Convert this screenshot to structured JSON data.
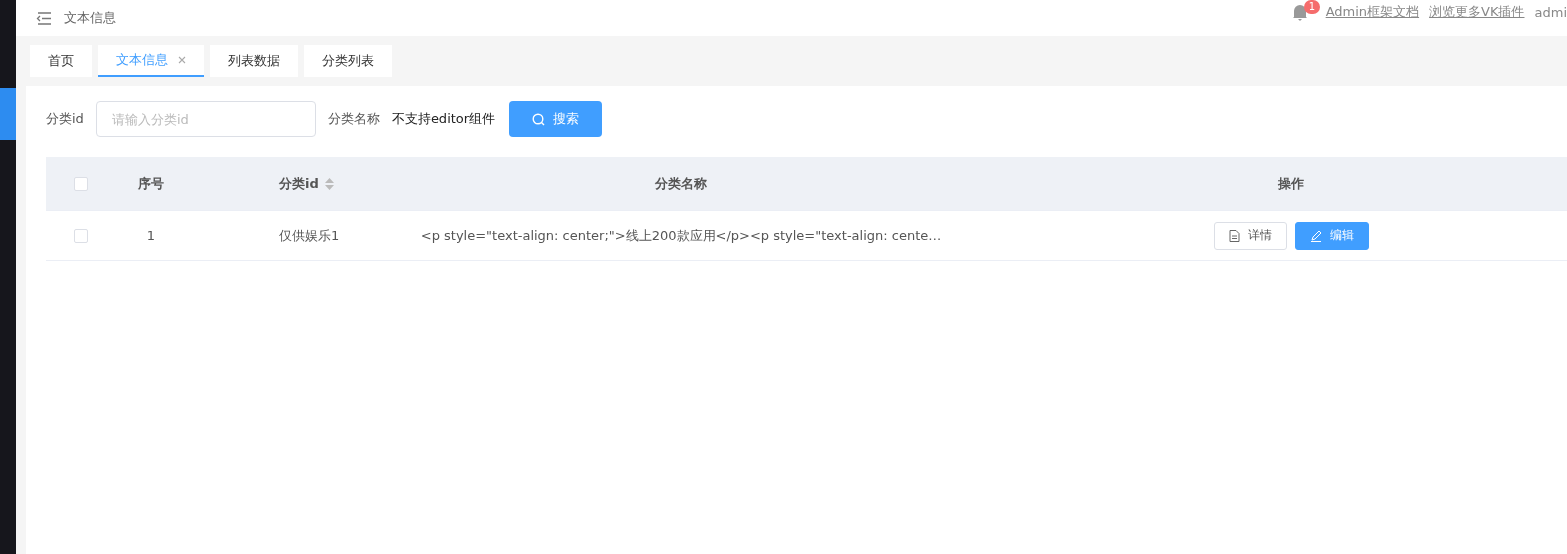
{
  "header": {
    "title": "文本信息",
    "notification_count": "1",
    "links": [
      "Admin框架文档",
      "浏览更多VK插件"
    ],
    "user": "admi"
  },
  "tabs": [
    {
      "label": "首页",
      "selected": false,
      "closable": false
    },
    {
      "label": "文本信息",
      "selected": true,
      "closable": true
    },
    {
      "label": "列表数据",
      "selected": false,
      "closable": false
    },
    {
      "label": "分类列表",
      "selected": false,
      "closable": false
    }
  ],
  "search_form": {
    "fields": [
      {
        "kind": "input",
        "label": "分类id",
        "placeholder": "请输入分类id"
      },
      {
        "kind": "note",
        "label": "分类名称",
        "value": "不支持editor组件"
      }
    ],
    "button": "搜索"
  },
  "table": {
    "all_checked": false,
    "columns": [
      {
        "label": "序号",
        "sortable": false
      },
      {
        "label": "分类id",
        "sortable": true
      },
      {
        "label": "分类名称",
        "sortable": false
      },
      {
        "label": "操作",
        "sortable": false
      }
    ],
    "rows": [
      {
        "checked": false,
        "cells": [
          "1",
          "仅供娱乐1",
          "<p style=\"text-align: center;\">线上200款应用</p><p style=\"text-align: cente…"
        ],
        "actions": [
          {
            "kind": "detail",
            "label": "详情"
          },
          {
            "kind": "edit",
            "label": "编辑"
          }
        ]
      }
    ]
  }
}
